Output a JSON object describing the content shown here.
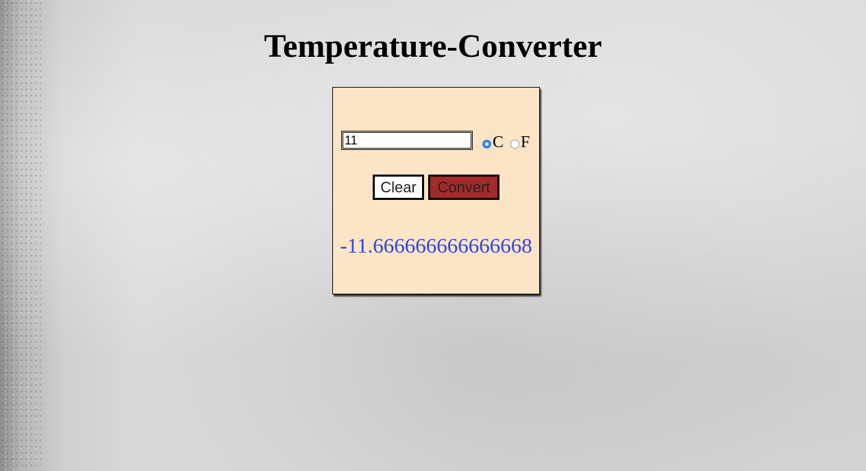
{
  "page": {
    "title": "Temperature-Converter"
  },
  "converter": {
    "input_value": "11",
    "units": [
      {
        "label": "C",
        "checked": true
      },
      {
        "label": "F",
        "checked": false
      }
    ],
    "clear_label": "Clear",
    "convert_label": "Convert",
    "result": "-11.666666666666668"
  },
  "colors": {
    "card_background": "#fce5c7",
    "convert_button": "#a32a2a",
    "result_text": "#2f45e0",
    "radio_selected": "#3b82f6"
  }
}
